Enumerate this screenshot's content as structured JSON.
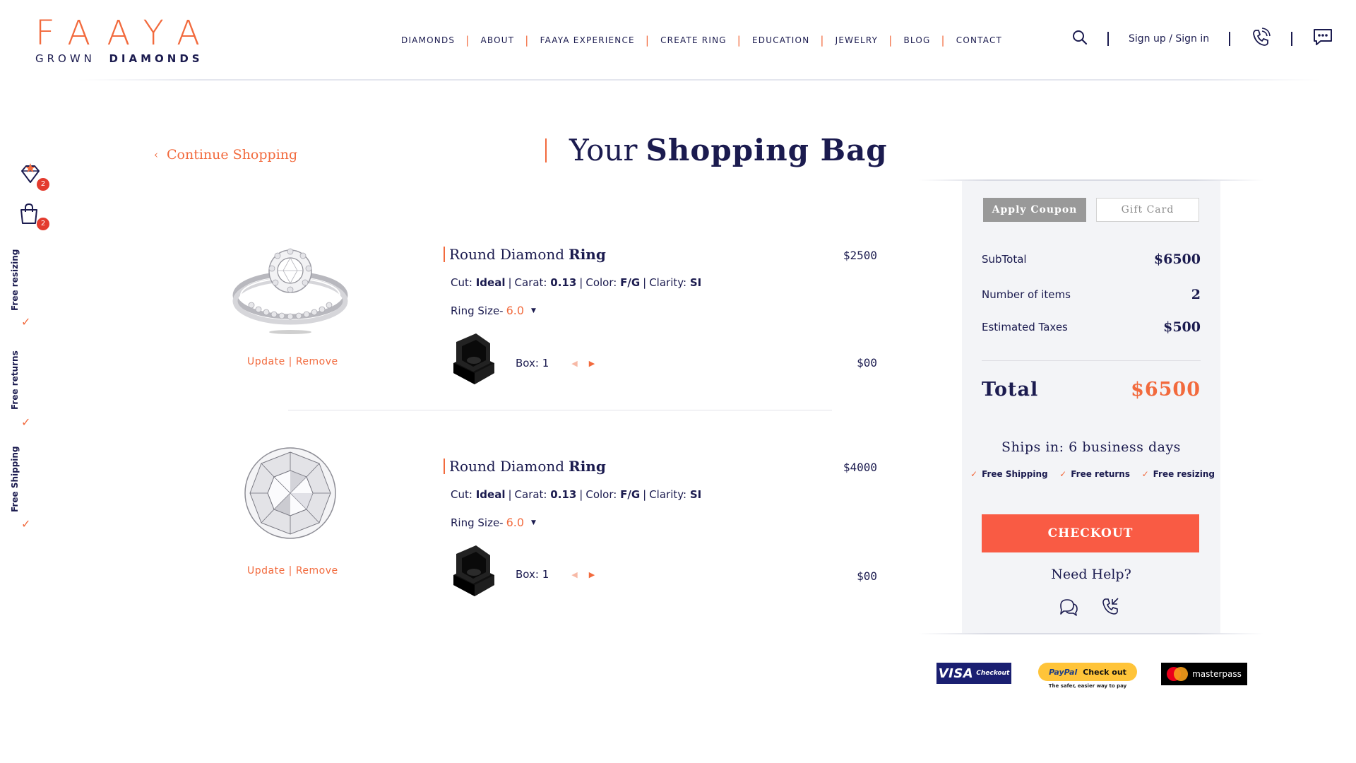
{
  "brand": {
    "name": "FAAYA",
    "sub_light": "GROWN",
    "sub_bold": "DIAMONDS",
    "accent_color": "#f26a3d",
    "navy_color": "#1b1b4f"
  },
  "nav": [
    "DIAMONDS",
    "ABOUT",
    "FAAYA EXPERIENCE",
    "CREATE RING",
    "EDUCATION",
    "JEWELRY",
    "BLOG",
    "CONTACT"
  ],
  "header": {
    "auth_label": "Sign up / Sign in",
    "icons": [
      "search-icon",
      "phone-icon",
      "chat-icon"
    ]
  },
  "rail": {
    "wishlist_count": "2",
    "bag_count": "2",
    "perks": [
      "Free resizing",
      "Free returns",
      "Free Shipping"
    ]
  },
  "page": {
    "continue_label": "Continue Shopping",
    "title_light": "Your",
    "title_bold": "Shopping Bag"
  },
  "items": [
    {
      "name_light": "Round Diamond",
      "name_bold": "Ring",
      "cut_label": "Cut:",
      "cut": "Ideal",
      "carat_label": "Carat:",
      "carat": "0.13",
      "color_label": "Color:",
      "color": "F/G",
      "clarity_label": "Clarity:",
      "clarity": "SI",
      "ring_size_label": "Ring Size-",
      "ring_size": "6.0",
      "box_label": "Box: 1",
      "price": "$2500",
      "box_price": "$00",
      "update_label": "Update",
      "remove_label": "Remove",
      "image": "ring-image"
    },
    {
      "name_light": "Round Diamond",
      "name_bold": "Ring",
      "cut_label": "Cut:",
      "cut": "Ideal",
      "carat_label": "Carat:",
      "carat": "0.13",
      "color_label": "Color:",
      "color": "F/G",
      "clarity_label": "Clarity:",
      "clarity": "SI",
      "ring_size_label": "Ring Size-",
      "ring_size": "6.0",
      "box_label": "Box: 1",
      "price": "$4000",
      "box_price": "$00",
      "update_label": "Update",
      "remove_label": "Remove",
      "image": "diamond-image"
    }
  ],
  "summary": {
    "tab_coupon": "Apply Coupon",
    "tab_gift": "Gift Card",
    "subtotal_label": "SubTotal",
    "subtotal": "$6500",
    "items_label": "Number of items",
    "items": "2",
    "taxes_label": "Estimated Taxes",
    "taxes": "$500",
    "total_label": "Total",
    "total": "$6500",
    "ships_label": "Ships in: 6 business days",
    "perks": [
      "Free Shipping",
      "Free returns",
      "Free resizing"
    ],
    "checkout_label": "CHECKOUT",
    "help_label": "Need Help?"
  },
  "payments": {
    "visa_big": "VISA",
    "visa_small": "Checkout",
    "paypal_brand": "PayPal",
    "paypal_action": "Check out",
    "paypal_tagline": "The safer, easier way to pay",
    "masterpass": "masterpass"
  }
}
